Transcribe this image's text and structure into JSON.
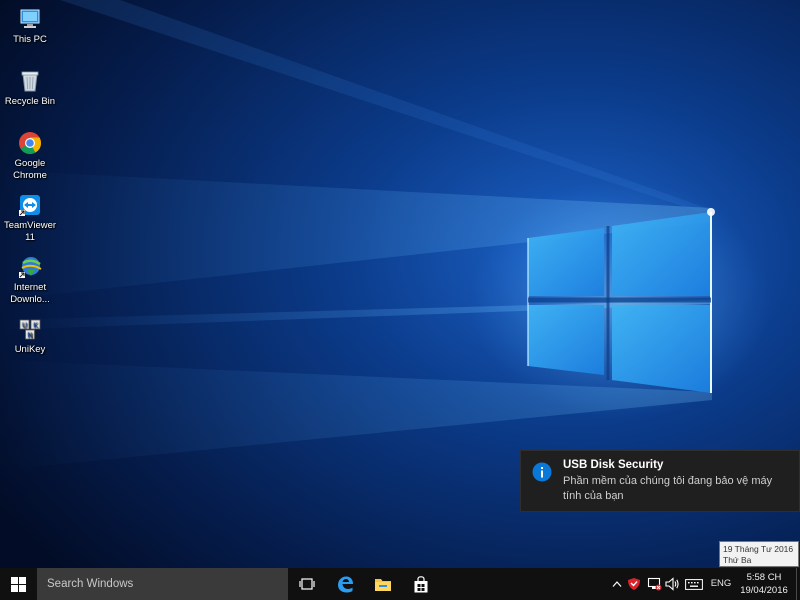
{
  "desktop": {
    "icons": [
      {
        "label": "This PC",
        "icon": "computer-icon"
      },
      {
        "label": "Recycle Bin",
        "icon": "recycle-bin-icon"
      },
      {
        "label": "Google Chrome",
        "icon": "chrome-icon"
      },
      {
        "label": "TeamViewer 11",
        "icon": "teamviewer-icon"
      },
      {
        "label": "Internet Downlo...",
        "icon": "idm-icon"
      },
      {
        "label": "UniKey",
        "icon": "unikey-icon"
      }
    ]
  },
  "notification": {
    "title": "USB Disk Security",
    "body": "Phần mềm của chúng tôi đang bảo vệ máy tính của bạn",
    "icon": "info-icon"
  },
  "tooltip": {
    "line1": "19 Tháng Tư 2016",
    "line2": "Thứ Ba"
  },
  "taskbar": {
    "search_placeholder": "Search Windows",
    "pinned": [
      "task-view-icon",
      "edge-icon",
      "file-explorer-icon",
      "store-icon"
    ],
    "tray": {
      "icons": [
        "chevron-up-icon",
        "shield-icon",
        "network-icon",
        "volume-icon",
        "keyboard-icon"
      ],
      "language": "ENG",
      "time": "5:58 CH",
      "date": "19/04/2016"
    }
  },
  "colors": {
    "accent": "#0a78d7",
    "taskbar": "#101010",
    "toast": "#1f1f1f",
    "wallpaper_dark": "#04153a",
    "wallpaper_glow": "#5fc8ff"
  }
}
